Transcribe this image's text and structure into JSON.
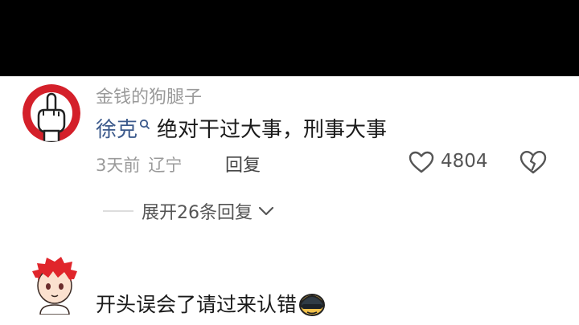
{
  "comment1": {
    "username": "金钱的狗腿子",
    "mention": "徐克",
    "text": "绝对干过大事，刑事大事",
    "time": "3天前",
    "location": "辽宁",
    "reply_label": "回复",
    "like_count": "4804",
    "icons": {
      "avatar": "middle-finger-avatar",
      "like": "heart-outline-icon",
      "dislike": "broken-heart-icon",
      "mention_marker": "search-icon"
    }
  },
  "expand": {
    "label": "展开26条回复"
  },
  "comment2": {
    "text": "开头误会了请过来认错",
    "icons": {
      "avatar": "red-hair-anime-avatar",
      "emoji": "helmet-emoji"
    }
  },
  "colors": {
    "background_top": "#000000",
    "panel": "#ffffff",
    "mention": "#3c5a8c",
    "muted": "#9a9a9a"
  }
}
